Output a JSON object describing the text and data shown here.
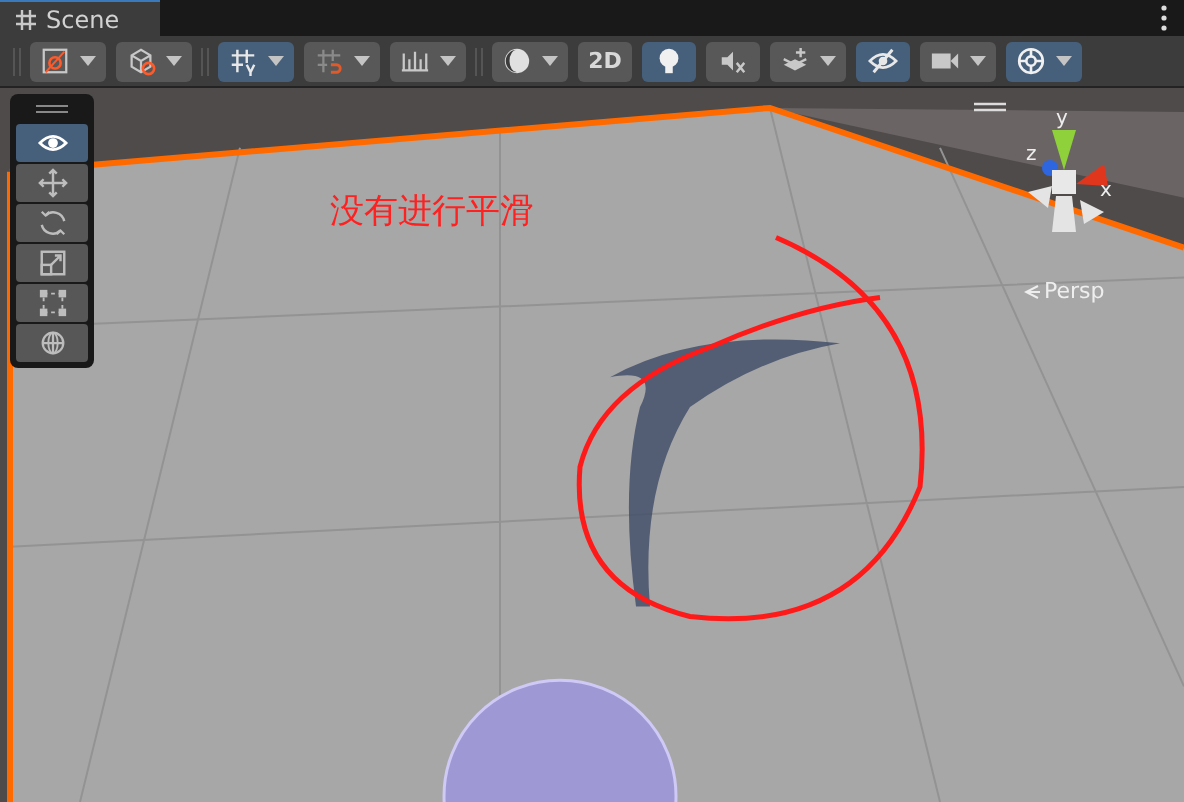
{
  "tab": {
    "label": "Scene",
    "selected": true
  },
  "toolbar": {
    "groups": [
      [
        {
          "kind": "icon",
          "dropdown": true,
          "selected": false
        },
        {
          "kind": "icon",
          "dropdown": true,
          "selected": false
        }
      ],
      [
        {
          "kind": "icon",
          "dropdown": true,
          "selected": true
        },
        {
          "kind": "icon",
          "dropdown": true,
          "selected": false
        },
        {
          "kind": "icon",
          "dropdown": true,
          "selected": false
        }
      ],
      [
        {
          "kind": "icon",
          "dropdown": true,
          "selected": false
        },
        {
          "kind": "text",
          "label": "2D",
          "dropdown": false,
          "selected": false
        },
        {
          "kind": "icon",
          "dropdown": false,
          "selected": true
        },
        {
          "kind": "icon",
          "dropdown": false,
          "selected": false
        },
        {
          "kind": "icon",
          "dropdown": true,
          "selected": false
        },
        {
          "kind": "icon",
          "dropdown": false,
          "selected": true
        },
        {
          "kind": "icon",
          "dropdown": true,
          "selected": false
        },
        {
          "kind": "icon",
          "dropdown": true,
          "selected": true
        }
      ]
    ]
  },
  "tools": [
    {
      "selected": true
    },
    {
      "selected": false
    },
    {
      "selected": false
    },
    {
      "selected": false
    },
    {
      "selected": false
    },
    {
      "selected": false
    }
  ],
  "gizmo": {
    "axes": [
      "y",
      "z",
      "x"
    ],
    "projection": "Persp"
  },
  "annotation": {
    "text": "没有进行平滑"
  }
}
